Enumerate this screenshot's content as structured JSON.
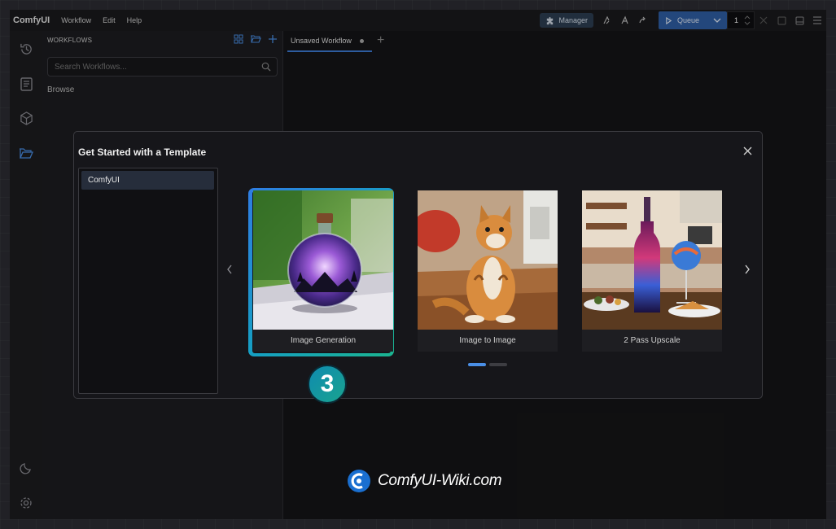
{
  "app": {
    "name": "ComfyUI"
  },
  "menu": {
    "items": [
      "Workflow",
      "Edit",
      "Help"
    ]
  },
  "toolbar": {
    "manager_label": "Manager",
    "queue_label": "Queue",
    "queue_count": "1"
  },
  "workflows": {
    "header": "WORKFLOWS",
    "search_placeholder": "Search Workflows...",
    "browse_label": "Browse"
  },
  "tabs": [
    {
      "label": "Unsaved Workflow"
    }
  ],
  "modal": {
    "title": "Get Started with a Template",
    "categories": [
      {
        "label": "ComfyUI",
        "selected": true
      }
    ],
    "templates": [
      {
        "label": "Image Generation",
        "selected": true
      },
      {
        "label": "Image to Image",
        "selected": false
      },
      {
        "label": "2 Pass Upscale",
        "selected": false
      }
    ],
    "page_index": 1,
    "page_count": 2
  },
  "step_badge": "3",
  "watermark": "ComfyUI-Wiki.com",
  "colors": {
    "accent": "#2f5fa6",
    "selection_start": "#2f7de3",
    "selection_end": "#1bb48f"
  }
}
